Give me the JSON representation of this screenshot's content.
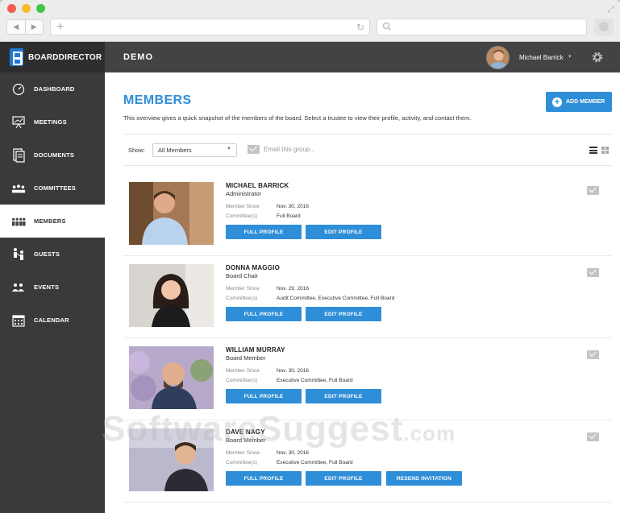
{
  "app": {
    "brand": "BOARDDIRECTOR",
    "org": "DEMO",
    "user_name": "Michael Barrick"
  },
  "sidebar": {
    "items": [
      {
        "label": "DASHBOARD",
        "icon": "dashboard-icon"
      },
      {
        "label": "MEETINGS",
        "icon": "meetings-icon"
      },
      {
        "label": "DOCUMENTS",
        "icon": "documents-icon"
      },
      {
        "label": "COMMITTEES",
        "icon": "committees-icon"
      },
      {
        "label": "MEMBERS",
        "icon": "members-icon",
        "active": true
      },
      {
        "label": "GUESTS",
        "icon": "guests-icon"
      },
      {
        "label": "EVENTS",
        "icon": "events-icon"
      },
      {
        "label": "CALENDAR",
        "icon": "calendar-icon"
      }
    ]
  },
  "page": {
    "title": "MEMBERS",
    "subtitle": "This overview gives a quick snapshot of the members of the board. Select a trustee to view their profile, activity, and contact them.",
    "add_member_label": "ADD MEMBER",
    "show_label": "Show:",
    "filter_value": "All Members",
    "email_group_label": "Email this group..."
  },
  "members": [
    {
      "name": "MICHAEL BARRICK",
      "role": "Administrator",
      "since_label": "Member Since",
      "since": "Nov. 30, 2016",
      "committees_label": "Committee(s)",
      "committees": "Full Board",
      "btn_profile": "FULL PROFILE",
      "btn_edit": "EDIT PROFILE"
    },
    {
      "name": "DONNA MAGGIO",
      "role": "Board Chair",
      "since_label": "Member Since",
      "since": "Nov. 29, 2016",
      "committees_label": "Committee(s)",
      "committees": "Audit Committee, Executive Committee, Full Board",
      "btn_profile": "FULL PROFILE",
      "btn_edit": "EDIT PROFILE"
    },
    {
      "name": "WILLIAM MURRAY",
      "role": "Board Member",
      "since_label": "Member Since",
      "since": "Nov. 30, 2016",
      "committees_label": "Committee(s)",
      "committees": "Executive Committee, Full Board",
      "btn_profile": "FULL PROFILE",
      "btn_edit": "EDIT PROFILE"
    },
    {
      "name": "DAVE NAGY",
      "role": "Board Member",
      "since_label": "Member Since",
      "since": "Nov. 30, 2016",
      "committees_label": "Committee(s)",
      "committees": "Executive Committee, Full Board",
      "btn_profile": "FULL PROFILE",
      "btn_edit": "EDIT PROFILE",
      "btn_resend": "RESEND INVITATION"
    }
  ],
  "watermark": {
    "main": "SoftwareSuggest",
    "suffix": ".com"
  },
  "colors": {
    "accent": "#2f8ed8",
    "sidebar": "#3a3a3a",
    "topbar": "#434343"
  }
}
